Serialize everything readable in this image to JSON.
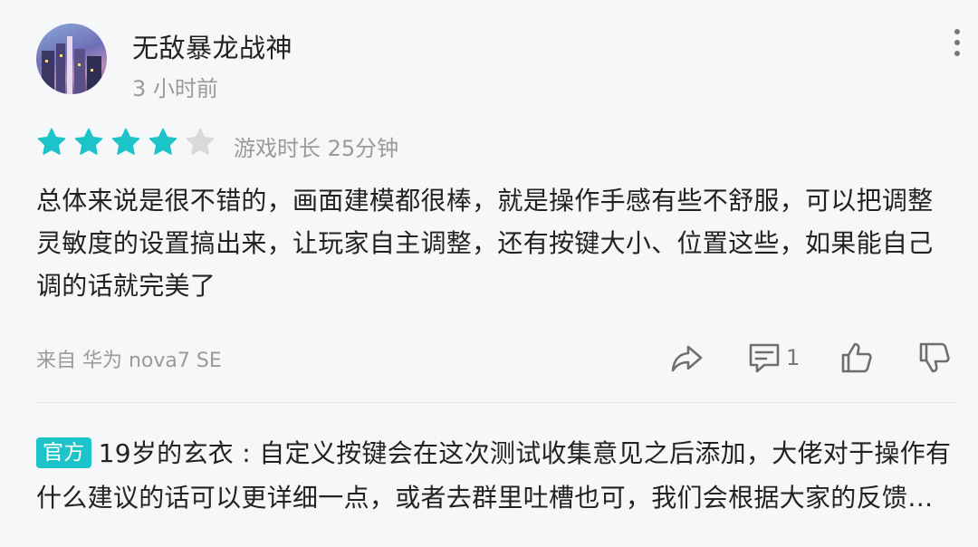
{
  "user": {
    "name": "无敌暴龙战神",
    "time_ago": "3 小时前"
  },
  "rating": {
    "stars": 4,
    "max_stars": 5,
    "filled_color": "#1cc3c9",
    "empty_color": "#d9d9d9",
    "playtime": "游戏时长 25分钟"
  },
  "review": {
    "text": "总体来说是很不错的，画面建模都很棒，就是操作手感有些不舒服，可以把调整灵敏度的设置搞出来，让玩家自主调整，还有按键大小、位置这些，如果能自己调的话就完美了"
  },
  "footer": {
    "device": "来自 华为 nova7 SE",
    "comment_count": "1",
    "icons": [
      "share-icon",
      "comment-icon",
      "thumbs-up-icon",
      "thumbs-down-icon"
    ]
  },
  "reply": {
    "badge": "官方",
    "author": "19岁的玄衣",
    "separator": " : ",
    "text": "自定义按键会在这次测试收集意见之后添加，大佬对于操作有什么建议的话可以更详细一点，或者去群里吐槽也可，我们会根据大家的反馈进行调整"
  }
}
